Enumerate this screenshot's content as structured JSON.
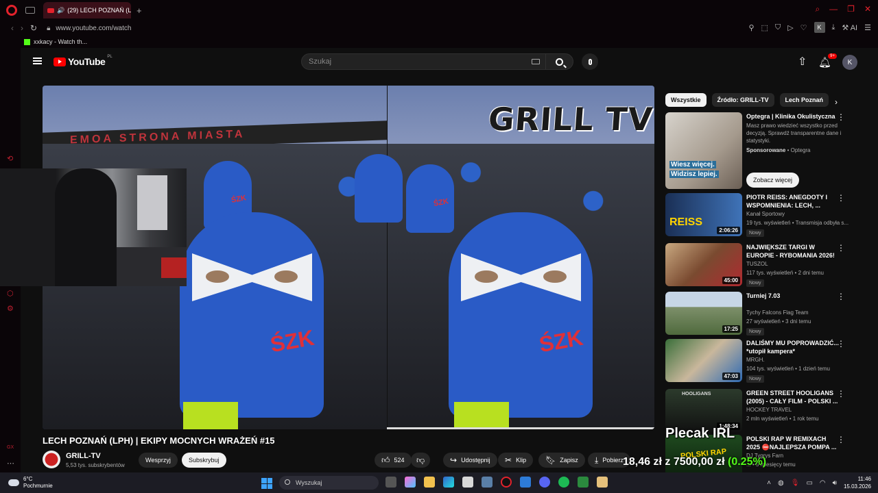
{
  "browser": {
    "tab_title": "(29) LECH POZNAŃ (LI",
    "url": "www.youtube.com/watch",
    "bookmark_label": "xxkacy - Watch th...",
    "ai_label": "AI",
    "account_initial": "K"
  },
  "youtube": {
    "logo_text": "YouTube",
    "logo_country": "PL",
    "search_placeholder": "Szukaj",
    "notif_badge": "9+",
    "avatar_initial": "K"
  },
  "video": {
    "title": "LECH POZNAŃ (LPH) | EKIPY MOCNYCH WRAŻEŃ #15",
    "overlay_text": "GRILL TV",
    "banner_text": "EMOA STRONA MIASTA",
    "channel_name": "GRILL-TV",
    "channel_subs": "5,53 tys. subskrybentów",
    "support_label": "Wesprzyj",
    "subscribe_label": "Subskrybuj",
    "likes": "524",
    "share_label": "Udostępnij",
    "clip_label": "Klip",
    "save_label": "Zapisz",
    "download_label": "Pobierz"
  },
  "sidebar": {
    "chips": [
      "Wszystkie",
      "Źródło: GRILL-TV",
      "Lech Poznań"
    ],
    "ad": {
      "title": "Optegra | Klinika Okulistyczna",
      "desc": "Masz prawo wiedzieć wszystko przed decyzją. Sprawdź transparentne dane i statystyki.",
      "sponsored": "Sponsorowane",
      "advertiser": "Optegra",
      "cta": "Zobacz więcej",
      "thumb_line1": "Wiesz więcej.",
      "thumb_line2": "Widzisz lepiej."
    },
    "items": [
      {
        "title": "PIOTR REISS: ANEGDOTY I WSPOMNIENIA: LECH, ...",
        "channel": "Kanał Sportowy",
        "meta": "19 tys. wyświetleń • Transmisja odbyła s...",
        "duration": "2:06:26",
        "badge": "Nowy",
        "thumb_text": "REISS"
      },
      {
        "title": "NAJWIĘKSZE TARGI W EUROPIE - RYBOMANIA 2026!",
        "channel": "TUSZOL",
        "meta": "117 tys. wyświetleń • 2 dni temu",
        "duration": "45:00",
        "badge": "Nowy",
        "thumb_text": ""
      },
      {
        "title": "Turniej 7.03",
        "channel": "Tychy Falcons Flag Team",
        "meta": "27 wyświetleń • 3 dni temu",
        "duration": "17:25",
        "badge": "Nowy",
        "thumb_text": ""
      },
      {
        "title": "DALIŚMY MU POPROWADZIĆ... *utopił kampera*",
        "channel": "MRGH.",
        "meta": "104 tys. wyświetleń • 1 dzień temu",
        "duration": "47:03",
        "badge": "Nowy",
        "thumb_text": ""
      },
      {
        "title": "GREEN STREET HOOLIGANS (2005) - CAŁY FILM - POLSKI ...",
        "channel": "HOCKEY TRAVEL",
        "meta": "2 mln wyświetleń • 1 rok temu",
        "duration": "1:48:34",
        "badge": "",
        "thumb_text": "HOOLIGANS"
      },
      {
        "title": "POLSKI RAP W REMIXACH 2025 ⛔NAJLEPSZA POMPA ...",
        "channel": "DJ Tygrys Farn",
        "meta": "... • 5 miesięcy temu",
        "duration": "",
        "badge": "",
        "thumb_text": "POLSKI RAP"
      }
    ]
  },
  "stream_overlay": {
    "plecak": "Plecak IRL",
    "money": "18,46 zł z 7500,00 zł",
    "percent": "(0.25%)"
  },
  "taskbar": {
    "temp": "6°C",
    "weather": "Pochmurnie",
    "search_label": "Wyszukaj",
    "time": "11:46",
    "date": "15.03.2026"
  }
}
